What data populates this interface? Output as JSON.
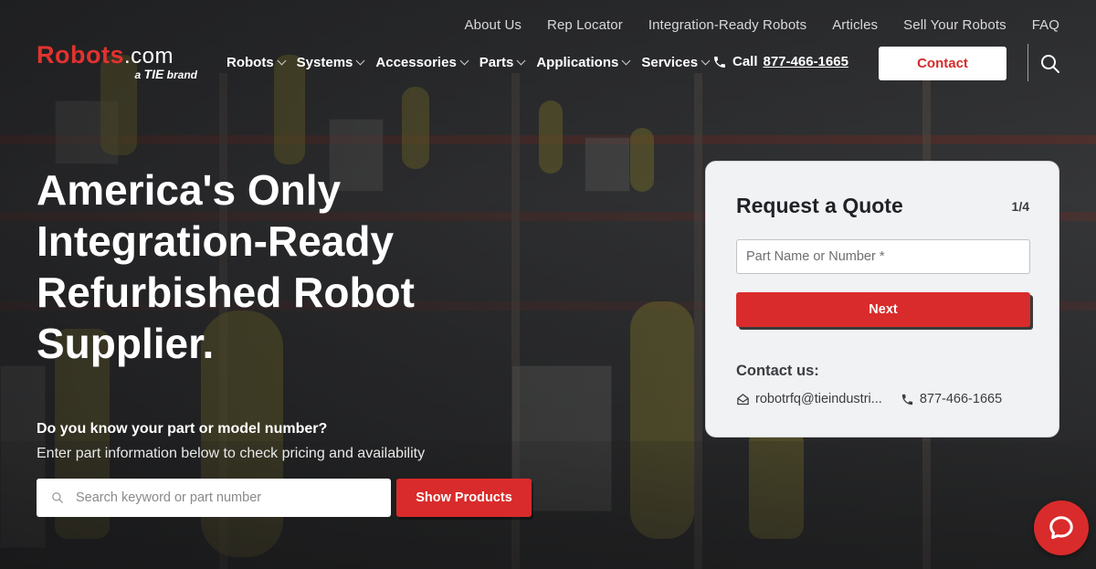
{
  "top_nav": [
    "About Us",
    "Rep Locator",
    "Integration-Ready Robots",
    "Articles",
    "Sell Your Robots",
    "FAQ"
  ],
  "logo": {
    "main": "Robots",
    "domain": ".com",
    "sub_prefix": "a",
    "sub_brand": "TIE",
    "sub_suffix": "brand"
  },
  "main_nav": [
    "Robots",
    "Systems",
    "Accessories",
    "Parts",
    "Applications",
    "Services"
  ],
  "call": {
    "label": "Call",
    "number": "877-466-1665"
  },
  "contact_button": "Contact",
  "hero": {
    "title": "America's Only Integration-Ready Refurbished Robot Supplier.",
    "question": "Do you know your part or model number?",
    "subtitle": "Enter part information below to check pricing and availability",
    "search_placeholder": "Search keyword or part number",
    "show_button": "Show Products"
  },
  "quote": {
    "title": "Request a Quote",
    "step": "1/4",
    "input_placeholder": "Part Name or Number *",
    "next_button": "Next",
    "contact_label": "Contact us:",
    "email": "robotrfq@tieindustri...",
    "phone": "877-466-1665"
  },
  "colors": {
    "brand_red": "#d92b2b",
    "white": "#ffffff"
  }
}
